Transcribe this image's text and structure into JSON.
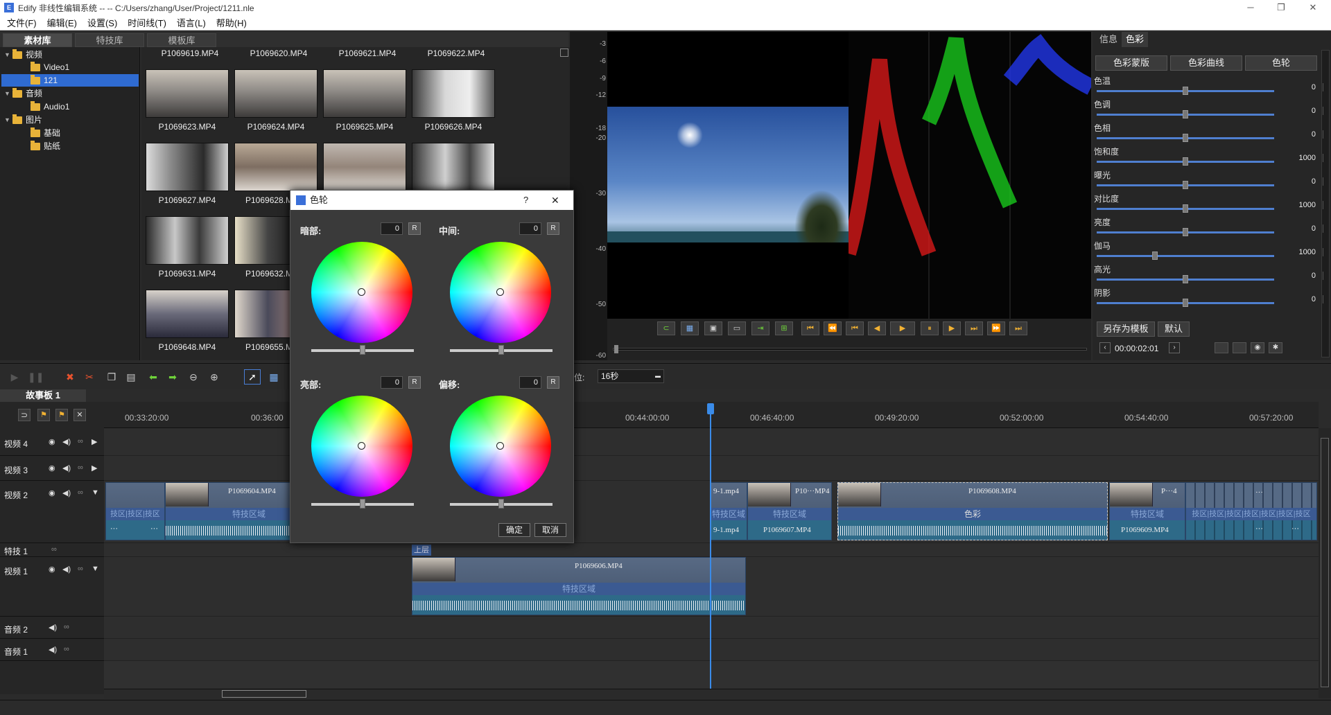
{
  "window": {
    "title": "Edify 非线性编辑系统 --  -- C:/Users/zhang/User/Project/1211.nle",
    "logo": "E"
  },
  "menu": [
    "文件(F)",
    "编辑(E)",
    "设置(S)",
    "时间线(T)",
    "语言(L)",
    "帮助(H)"
  ],
  "library_tabs": [
    "素材库",
    "特技库",
    "模板库"
  ],
  "tree": [
    {
      "label": "视频",
      "expanded": true
    },
    {
      "label": "Video1"
    },
    {
      "label": "121",
      "selected": true
    },
    {
      "label": "音频",
      "expanded": true
    },
    {
      "label": "Audio1"
    },
    {
      "label": "图片",
      "expanded": true
    },
    {
      "label": "基础"
    },
    {
      "label": "贴纸"
    }
  ],
  "media": {
    "header_row": [
      "P1069619.MP4",
      "P1069620.MP4",
      "P1069621.MP4",
      "P1069622.MP4"
    ],
    "row1": [
      "P1069623.MP4",
      "P1069624.MP4",
      "P1069625.MP4",
      "P1069626.MP4"
    ],
    "row2": [
      "P1069627.MP4",
      "P1069628.M"
    ],
    "row3": [
      "P1069631.MP4",
      "P1069632.M"
    ],
    "row4": [
      "P1069648.MP4",
      "P1069655.M"
    ]
  },
  "scope_ticks": [
    "-3",
    "-6",
    "-9",
    "-12",
    "-18",
    "-20",
    "-30",
    "-40",
    "-50",
    "-60"
  ],
  "right_panel": {
    "tabs": [
      "信息",
      "色彩"
    ],
    "active_tab": "色彩",
    "subtabs": [
      "色彩蒙版",
      "色彩曲线",
      "色轮"
    ],
    "params": [
      {
        "label": "色温",
        "value": "0",
        "level": 0.5
      },
      {
        "label": "色调",
        "value": "0",
        "level": 0.5
      },
      {
        "label": "色相",
        "value": "0",
        "level": 0.5
      },
      {
        "label": "饱和度",
        "value": "1000",
        "level": 0.5
      },
      {
        "label": "曝光",
        "value": "0",
        "level": 0.5
      },
      {
        "label": "对比度",
        "value": "1000",
        "level": 0.5
      },
      {
        "label": "亮度",
        "value": "0",
        "level": 0.5
      },
      {
        "label": "伽马",
        "value": "1000",
        "level": 0.33
      },
      {
        "label": "高光",
        "value": "0",
        "level": 0.5
      },
      {
        "label": "阴影",
        "value": "0",
        "level": 0.5
      }
    ],
    "save_template": "另存为模板",
    "default": "默认",
    "timecode": "00:00:02:01"
  },
  "toolbar": {
    "unit_label": "位:",
    "unit_value": "16秒"
  },
  "storyboard_tab": "故事板 1",
  "ruler": [
    "00:33:20:00",
    "00:36:00",
    "00:44:00:00",
    "00:46:40:00",
    "00:49:20:00",
    "00:52:00:00",
    "00:54:40:00",
    "00:57:20:00"
  ],
  "tracks": [
    {
      "name": "视频 4"
    },
    {
      "name": "视频 3"
    },
    {
      "name": "视频 2"
    },
    {
      "name": "特技 1"
    },
    {
      "name": "视频 1"
    },
    {
      "name": "音频 2"
    },
    {
      "name": "音频 1"
    }
  ],
  "clips": {
    "v2_a_title": "P1069604.MP4",
    "v2_a_fx": "特技区域",
    "v2_left_fx": "技区|技区|技区",
    "v2_b_title": "9-1.mp4",
    "v2_b_bot": "9-1.mp4",
    "v2_c_title": "P10···MP4",
    "v2_c_fx": "特技区域",
    "v2_c_bot": "P1069607.MP4",
    "v2_d_title": "P1069608.MP4",
    "v2_d_fx": "色彩",
    "v2_e_title": "P···4",
    "v2_e_fx": "特技区域",
    "v2_e_bot": "P1069609.MP4",
    "v2_right_fx": "技区|技区|技区|技区|技区|技区|技区",
    "fx1_label": "上层",
    "v1_title": "P1069606.MP4",
    "v1_fx": "特技区域",
    "ellipsis": "···"
  },
  "dialog": {
    "title": "色轮",
    "help": "?",
    "close": "✕",
    "wheels": [
      {
        "label": "暗部:",
        "value": "0"
      },
      {
        "label": "中间:",
        "value": "0"
      },
      {
        "label": "亮部:",
        "value": "0"
      },
      {
        "label": "偏移:",
        "value": "0"
      }
    ],
    "reset": "R",
    "ok": "确定",
    "cancel": "取消"
  }
}
